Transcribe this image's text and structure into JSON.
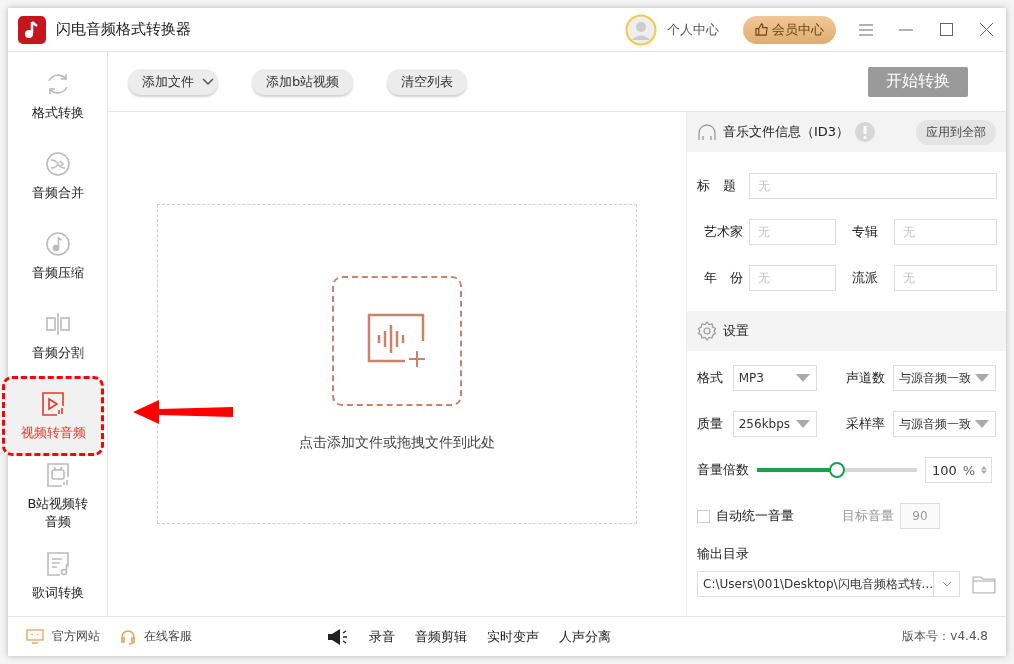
{
  "window": {
    "title": "闪电音频格式转换器"
  },
  "header": {
    "user": "个人中心",
    "vip": "会员中心"
  },
  "sidebar": {
    "items": [
      {
        "label": "格式转换",
        "kind": "convert",
        "selected": false,
        "highlighted": false
      },
      {
        "label": "音频合并",
        "kind": "merge",
        "selected": false,
        "highlighted": false
      },
      {
        "label": "音频压缩",
        "kind": "compress",
        "selected": false,
        "highlighted": false
      },
      {
        "label": "音频分割",
        "kind": "split",
        "selected": false,
        "highlighted": false
      },
      {
        "label": "视频转音频",
        "kind": "video",
        "selected": true,
        "highlighted": true
      },
      {
        "label": "B站视频转音频",
        "kind": "bili",
        "selected": false,
        "highlighted": false
      },
      {
        "label": "歌词转换",
        "kind": "lyrics",
        "selected": false,
        "highlighted": false
      }
    ]
  },
  "toolbar": {
    "add_file": "添加文件",
    "add_bili": "添加b站视频",
    "clear": "清空列表",
    "start": "开始转换"
  },
  "drop_zone": {
    "hint": "点击添加文件或拖拽文件到此处"
  },
  "id3": {
    "title": "音乐文件信息（ID3）",
    "apply_all": "应用到全部",
    "fields": [
      {
        "label": "标　题",
        "placeholder": "无"
      },
      {
        "label": "艺术家",
        "placeholder": "无"
      },
      {
        "label": "专辑",
        "placeholder": "无"
      },
      {
        "label": "年　份",
        "placeholder": "无"
      },
      {
        "label": "流派",
        "placeholder": "无"
      }
    ]
  },
  "settings": {
    "title": "设置",
    "format": {
      "label": "格式",
      "value": "MP3"
    },
    "channels": {
      "label": "声道数",
      "value": "与源音频一致"
    },
    "quality": {
      "label": "质量",
      "value": "256kbps"
    },
    "sample_rate": {
      "label": "采样率",
      "value": "与源音频一致"
    },
    "volume": {
      "label": "音量倍数",
      "level": 0.5,
      "value": "100",
      "unit": "%"
    },
    "auto_volume": {
      "label": "自动统一音量",
      "checked": false
    },
    "target_volume": {
      "label": "目标音量",
      "value": "90",
      "disabled": true
    },
    "output": {
      "label": "输出目录",
      "value": "C:\\Users\\001\\Desktop\\闪电音频格式转..."
    }
  },
  "footer": {
    "links": [
      "官方网站",
      "在线客服"
    ],
    "tools": [
      "录音",
      "音频剪辑",
      "实时变声",
      "人声分离"
    ],
    "version": "版本号：v4.4.8"
  }
}
